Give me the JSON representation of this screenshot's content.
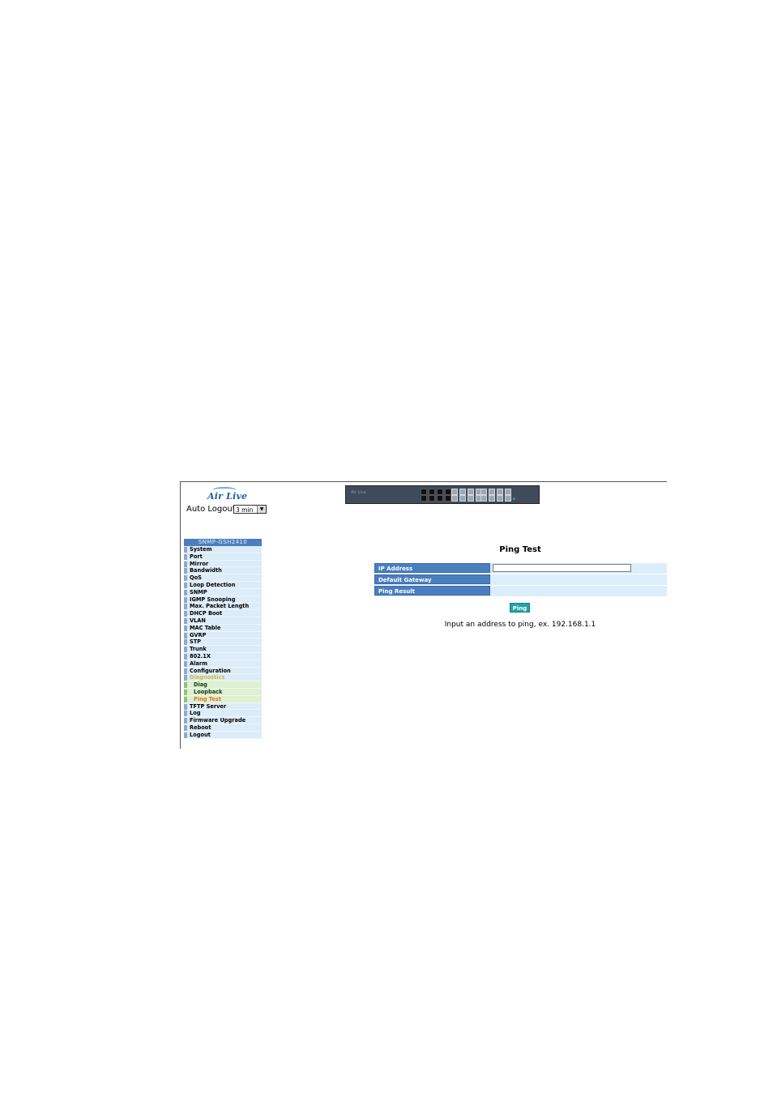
{
  "logo": {
    "text": "Air Live"
  },
  "auto_logout": {
    "label": "Auto Logout",
    "value": "3 min"
  },
  "device": {
    "brand": "Air Live"
  },
  "menu": {
    "header": "SNMP-GSH2410",
    "items": [
      {
        "label": "System"
      },
      {
        "label": "Port"
      },
      {
        "label": "Mirror"
      },
      {
        "label": "Bandwidth"
      },
      {
        "label": "QoS"
      },
      {
        "label": "Loop Detection"
      },
      {
        "label": "SNMP"
      },
      {
        "label": "IGMP Snooping"
      },
      {
        "label": "Max. Packet Length"
      },
      {
        "label": "DHCP Boot"
      },
      {
        "label": "VLAN"
      },
      {
        "label": "MAC Table"
      },
      {
        "label": "GVRP"
      },
      {
        "label": "STP"
      },
      {
        "label": "Trunk"
      },
      {
        "label": "802.1X"
      },
      {
        "label": "Alarm"
      },
      {
        "label": "Configuration"
      },
      {
        "label": "Diagnostics"
      },
      {
        "label": "Diag"
      },
      {
        "label": "Loopback"
      },
      {
        "label": "Ping Test"
      },
      {
        "label": "TFTP Server"
      },
      {
        "label": "Log"
      },
      {
        "label": "Firmware Upgrade"
      },
      {
        "label": "Reboot"
      },
      {
        "label": "Logout"
      }
    ]
  },
  "main": {
    "title": "Ping Test",
    "fields": [
      {
        "label": "IP Address",
        "value": ""
      },
      {
        "label": "Default Gateway",
        "value": ""
      },
      {
        "label": "Ping Result",
        "value": ""
      }
    ],
    "ping_button": "Ping",
    "hint": "Input an address to ping, ex. 192.168.1.1"
  },
  "colors": {
    "menu_header": "#4a7fbf",
    "menu_item_bg": "#dcecf9",
    "sub_item_bg": "#dff0cf",
    "active_item": "#e07a0b",
    "button": "#21a3a9"
  }
}
